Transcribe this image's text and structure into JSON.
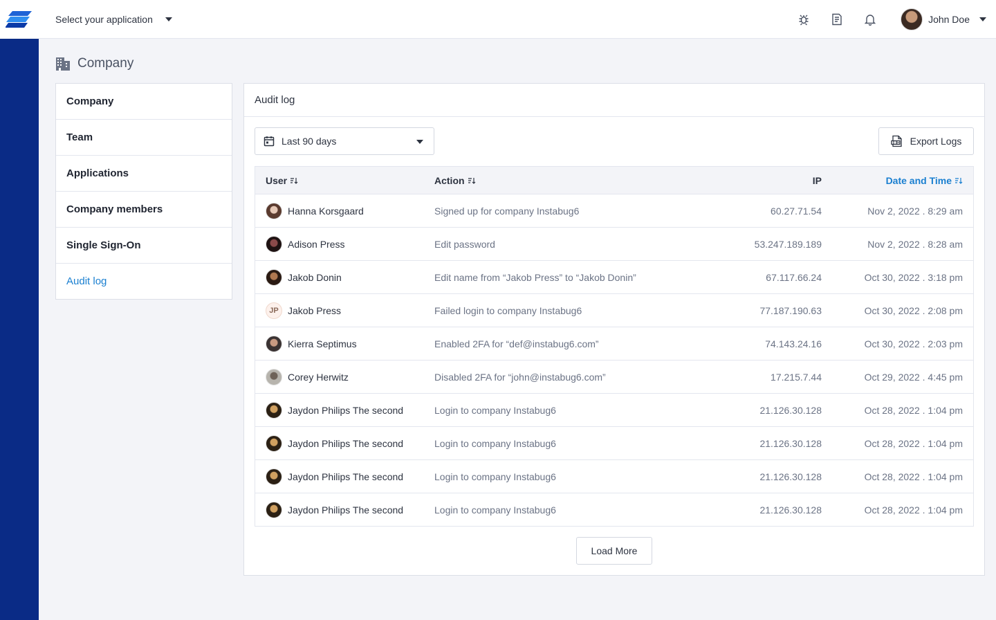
{
  "topbar": {
    "app_select": "Select your application",
    "icons": [
      "bug-icon",
      "document-icon",
      "bell-icon"
    ],
    "user_name": "John Doe"
  },
  "page": {
    "title": "Company",
    "icon": "building-icon"
  },
  "sidebar": {
    "items": [
      {
        "label": "Company",
        "active": false
      },
      {
        "label": "Team",
        "active": false
      },
      {
        "label": "Applications",
        "active": false
      },
      {
        "label": "Company members",
        "active": false
      },
      {
        "label": "Single Sign-On",
        "active": false
      },
      {
        "label": "Audit log",
        "active": true
      }
    ]
  },
  "audit": {
    "title": "Audit log",
    "filter": {
      "value": "Last 90 days",
      "icon": "calendar-icon"
    },
    "export_label": "Export Logs",
    "columns": {
      "user": "User",
      "action": "Action",
      "ip": "IP",
      "date": "Date and Time"
    },
    "sorted_column": "date",
    "rows": [
      {
        "user": "Hanna Korsgaard",
        "avatar": "photo",
        "action": "Signed up for company Instabug6",
        "ip": "60.27.71.54",
        "date": "Nov 2, 2022 . 8:29 am"
      },
      {
        "user": "Adison Press",
        "avatar": "photo",
        "action": "Edit password",
        "ip": "53.247.189.189",
        "date": "Nov 2, 2022 . 8:28 am"
      },
      {
        "user": "Jakob Donin",
        "avatar": "photo",
        "action": "Edit name from “Jakob Press” to “Jakob Donin”",
        "ip": "67.117.66.24",
        "date": "Oct 30, 2022 . 3:18 pm"
      },
      {
        "user": "Jakob Press",
        "avatar": "JP",
        "action": "Failed login to company Instabug6",
        "ip": "77.187.190.63",
        "date": "Oct 30, 2022 . 2:08 pm"
      },
      {
        "user": "Kierra Septimus",
        "avatar": "photo",
        "action": "Enabled 2FA for “def@instabug6.com”",
        "ip": "74.143.24.16",
        "date": "Oct 30, 2022 . 2:03 pm"
      },
      {
        "user": "Corey Herwitz",
        "avatar": "photo",
        "action": "Disabled 2FA for “john@instabug6.com”",
        "ip": "17.215.7.44",
        "date": "Oct 29, 2022 . 4:45 pm"
      },
      {
        "user": "Jaydon Philips The second",
        "avatar": "photo",
        "action": "Login to company Instabug6",
        "ip": "21.126.30.128",
        "date": "Oct 28, 2022 . 1:04 pm"
      },
      {
        "user": "Jaydon Philips The second",
        "avatar": "photo",
        "action": "Login to company Instabug6",
        "ip": "21.126.30.128",
        "date": "Oct 28, 2022 . 1:04 pm"
      },
      {
        "user": "Jaydon Philips The second",
        "avatar": "photo",
        "action": "Login to company Instabug6",
        "ip": "21.126.30.128",
        "date": "Oct 28, 2022 . 1:04 pm"
      },
      {
        "user": "Jaydon Philips The second",
        "avatar": "photo",
        "action": "Login to company Instabug6",
        "ip": "21.126.30.128",
        "date": "Oct 28, 2022 . 1:04 pm"
      }
    ],
    "load_more": "Load More"
  },
  "colors": {
    "rail": "#0a2b86",
    "accent": "#1a7fd0",
    "background": "#f3f4f8"
  }
}
